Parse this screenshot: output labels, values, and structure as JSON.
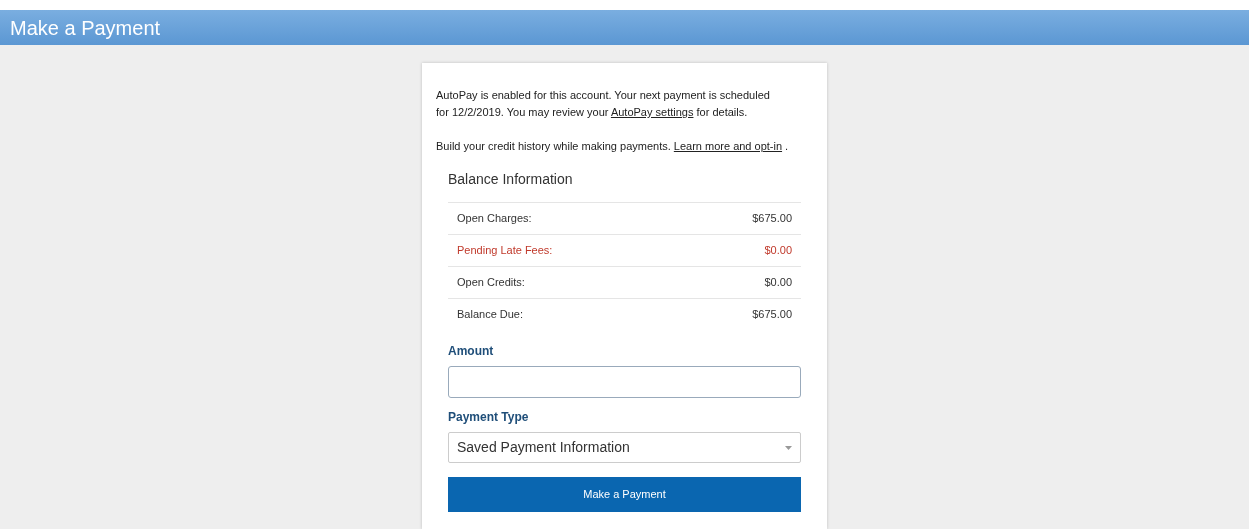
{
  "header": {
    "title": "Make a Payment"
  },
  "notices": [
    {
      "before": "AutoPay is enabled for this account. Your next payment is scheduled for 12/2/2019. You may review your ",
      "link": "AutoPay settings",
      "after": " for details."
    },
    {
      "before": "Build your credit history while making payments. ",
      "link": "Learn more and opt-in",
      "after": " ."
    }
  ],
  "balance": {
    "title": "Balance Information",
    "rows": [
      {
        "label": "Open Charges:",
        "value": "$675.00",
        "alert": false
      },
      {
        "label": "Pending Late Fees:",
        "value": "$0.00",
        "alert": true
      },
      {
        "label": "Open Credits:",
        "value": "$0.00",
        "alert": false
      },
      {
        "label": "Balance Due:",
        "value": "$675.00",
        "alert": false
      }
    ]
  },
  "amount": {
    "label": "Amount"
  },
  "payment_type": {
    "label": "Payment Type",
    "value": "Saved Payment Information"
  },
  "submit": "Make a Payment"
}
